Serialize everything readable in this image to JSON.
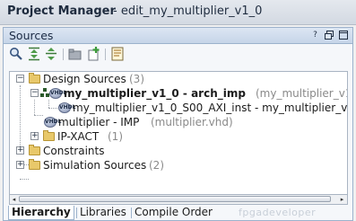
{
  "title_bar": {
    "title": "Project Manager",
    "project": "- edit_my_multiplier_v1_0"
  },
  "sources_panel": {
    "title": "Sources",
    "header_buttons": [
      "question-icon",
      "restore-icon",
      "maximize-icon"
    ],
    "toolbar_icons": [
      "search-icon",
      "collapse-all-icon",
      "expand-all-icon",
      "open-folder-icon",
      "add-sources-icon",
      "properties-icon"
    ]
  },
  "tree": {
    "design_sources": {
      "label": "Design Sources",
      "count": "(3)"
    },
    "top_module": {
      "label": "my_multiplier_v1_0 - arch_imp",
      "file": "(my_multiplier_v1_0"
    },
    "axi_inst": {
      "label": "my_multiplier_v1_0_S00_AXI_inst - my_multiplier_v1_"
    },
    "multiplier": {
      "label": "multiplier - IMP",
      "file": "(multiplier.vhd)"
    },
    "ip_xact": {
      "label": "IP-XACT",
      "count": "(1)"
    },
    "constraints": {
      "label": "Constraints"
    },
    "simulation_sources": {
      "label": "Simulation Sources",
      "count": "(2)"
    }
  },
  "tabs": [
    {
      "label": "Hierarchy",
      "active": true
    },
    {
      "label": "Libraries",
      "active": false
    },
    {
      "label": "Compile Order",
      "active": false
    }
  ],
  "watermark": "fpgadeveloper",
  "colors": {
    "header_bg": "#c6d5e8",
    "panel_border": "#9cb2cc",
    "folder": "#e8c86a"
  }
}
